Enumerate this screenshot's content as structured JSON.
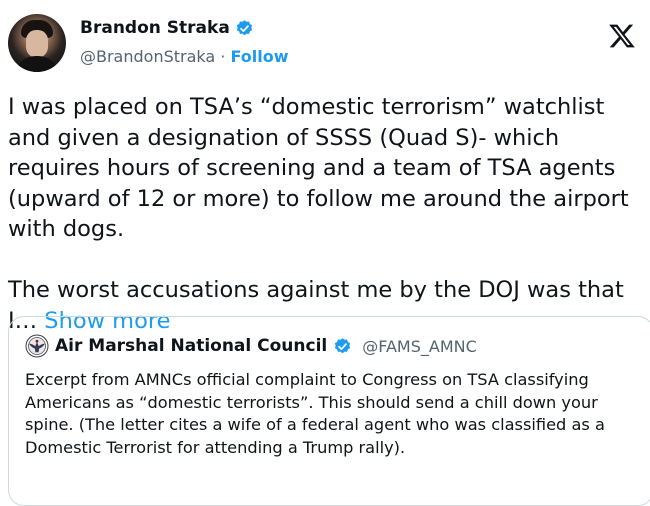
{
  "author": {
    "name": "Brandon Straka",
    "handle": "@BrandonStraka",
    "separator": " · ",
    "follow_label": "Follow"
  },
  "tweet": {
    "text": "I was placed on TSA’s “domestic terrorism” watchlist and given a designation of SSSS (Quad S)- which requires hours of screening and a team of TSA agents (upward of 12 or more) to follow me around the airport with dogs.\n\nThe worst accusations against me by the DOJ was that I… ",
    "show_more_label": "Show more"
  },
  "quote": {
    "name": "Air Marshal National Council",
    "handle": "@FAMS_AMNC",
    "text": "Excerpt from AMNCs official complaint to Congress on TSA classifying Americans as “domestic terrorists”.  This should send a chill down your spine.  (The letter cites a wife of a federal agent who was classified as a Domestic Terrorist for attending a Trump rally)."
  },
  "icons": {
    "verified": "verified-badge-icon",
    "platform": "x-logo-icon",
    "org_seal": "air-marshal-seal-icon"
  },
  "colors": {
    "accent": "#1d9bf0",
    "text": "#0f1419",
    "secondary": "#536471",
    "border": "#cfd9de"
  }
}
